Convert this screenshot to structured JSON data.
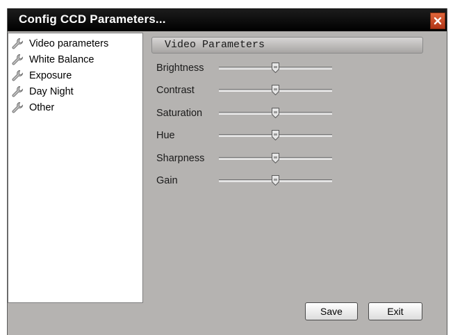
{
  "window": {
    "title": "Config CCD Parameters...",
    "close_icon": "close-icon"
  },
  "tree": {
    "items": [
      {
        "label": "Video parameters",
        "icon": "wrench-icon"
      },
      {
        "label": "White Balance",
        "icon": "wrench-icon"
      },
      {
        "label": "Exposure",
        "icon": "wrench-icon"
      },
      {
        "label": "Day Night",
        "icon": "wrench-icon"
      },
      {
        "label": "Other",
        "icon": "wrench-icon"
      }
    ]
  },
  "section": {
    "title": "Video Parameters"
  },
  "parameters": [
    {
      "label": "Brightness",
      "level": 0.5
    },
    {
      "label": "Contrast",
      "level": 0.5
    },
    {
      "label": "Saturation",
      "level": 0.5
    },
    {
      "label": "Hue",
      "level": 0.5
    },
    {
      "label": "Sharpness",
      "level": 0.5
    },
    {
      "label": "Gain",
      "level": 0.5
    }
  ],
  "buttons": {
    "save_label": "Save",
    "exit_label": "Exit"
  },
  "colors": {
    "title_bg": "#000000",
    "dialog_bg": "#b5b3b1",
    "close_bg": "#c8431f"
  }
}
